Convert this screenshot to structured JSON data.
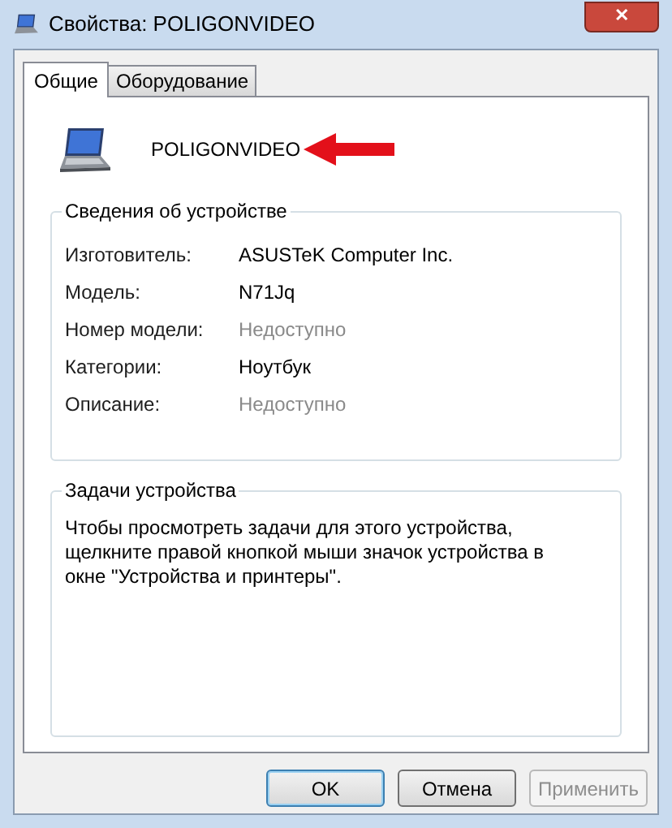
{
  "window": {
    "title": "Свойства: POLIGONVIDEO",
    "close": "✕"
  },
  "tabs": [
    {
      "label": "Общие",
      "selected": true
    },
    {
      "label": "Оборудование",
      "selected": false
    }
  ],
  "device": {
    "name": "POLIGONVIDEO"
  },
  "info_group": {
    "title": "Сведения об устройстве",
    "rows": [
      {
        "label": "Изготовитель:",
        "value": "ASUSTeK Computer Inc.",
        "disabled": false
      },
      {
        "label": "Модель:",
        "value": "N71Jq",
        "disabled": false
      },
      {
        "label": "Номер модели:",
        "value": "Недоступно",
        "disabled": true
      },
      {
        "label": "Категории:",
        "value": "Ноутбук",
        "disabled": false
      },
      {
        "label": "Описание:",
        "value": "Недоступно",
        "disabled": true
      }
    ]
  },
  "tasks_group": {
    "title": "Задачи устройства",
    "text": "Чтобы просмотреть задачи для этого устройства, щелкните правой кнопкой мыши значок устройства в окне \"Устройства и принтеры\"."
  },
  "buttons": [
    {
      "label": "OK",
      "default": true,
      "disabled": false
    },
    {
      "label": "Отмена",
      "default": false,
      "disabled": false
    },
    {
      "label": "Применить",
      "default": false,
      "disabled": true
    }
  ]
}
